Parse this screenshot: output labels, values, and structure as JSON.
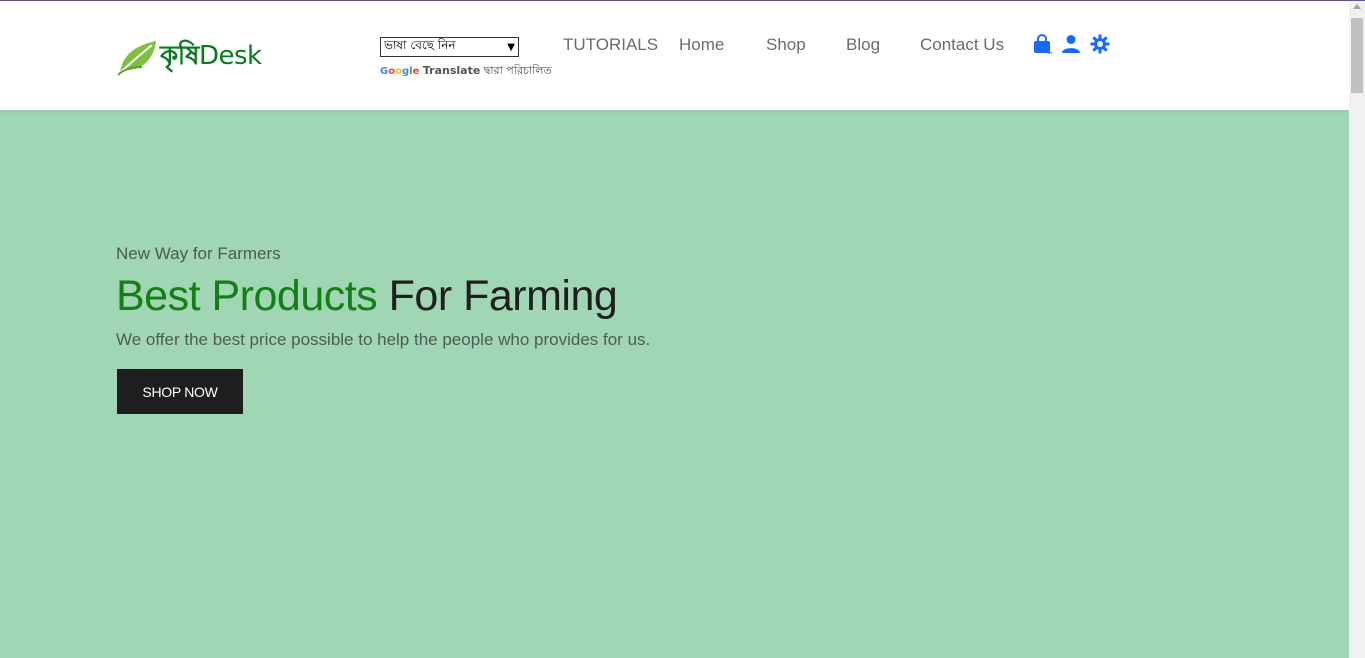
{
  "logo": {
    "bengali": "কৃষি",
    "latin": "Desk"
  },
  "language": {
    "select_value": "ভাষা বেছে নিন",
    "powered_by_google": [
      "G",
      "o",
      "o",
      "g",
      "l",
      "e"
    ],
    "translate_label": "Translate",
    "powered_suffix": "দ্বারা পরিচালিত"
  },
  "nav": {
    "tutorials": "TUTORIALS",
    "home": "Home",
    "shop": "Shop",
    "blog": "Blog",
    "contact": "Contact Us"
  },
  "icons": [
    "shopping-bag-icon",
    "user-icon",
    "settings-gear-icon"
  ],
  "hero": {
    "subtitle": "New Way for Farmers",
    "title_green": "Best Products",
    "title_rest": "For Farming",
    "description": "We offer the best price possible to help the people who provides for us.",
    "button": "SHOP NOW"
  },
  "colors": {
    "brand_green": "#138015",
    "hero_bg": "#a0d6b4",
    "icon_blue": "#1769ff",
    "button_bg": "#1e1e1e"
  }
}
